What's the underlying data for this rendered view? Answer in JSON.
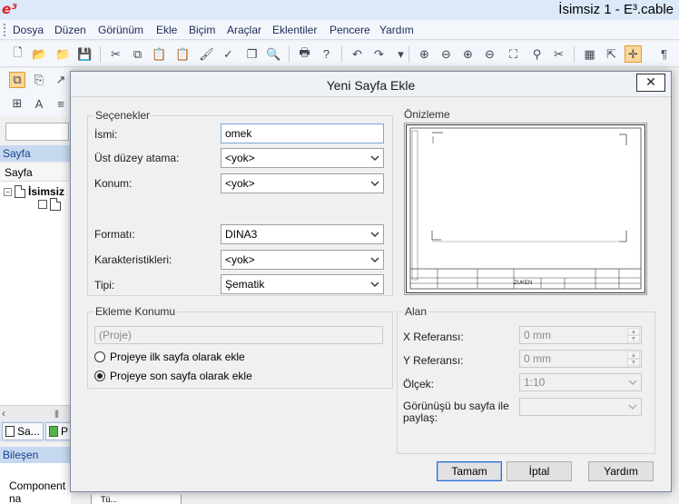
{
  "app": {
    "logo": "e³",
    "title": "İsimsiz 1 - E³.cable"
  },
  "menu": [
    "Dosya",
    "Düzen",
    "Görünüm",
    "Ekle",
    "Biçim",
    "Araçlar",
    "Eklentiler",
    "Pencere",
    "Yardım"
  ],
  "left_panel": {
    "sheet_panel_title": "Sayfa",
    "tree_header": "Sayfa",
    "tree_root": "İsimsiz",
    "bottom_tabs": [
      "Sa...",
      "P"
    ],
    "component_panel_title": "Bileşen",
    "component_label": "Component na",
    "bottom_strip_text": "Tü..."
  },
  "dialog": {
    "title": "Yeni Sayfa Ekle",
    "close_symbol": "✕",
    "options": {
      "legend": "Seçenekler",
      "name_label": "İsmi:",
      "name_value": "omek",
      "parent_label": "Üst düzey atama:",
      "parent_value": "<yok>",
      "location_label": "Konum:",
      "location_value": "<yok>",
      "format_label": "Formatı:",
      "format_value": "DINA3",
      "characteristics_label": "Karakteristikleri:",
      "characteristics_value": "<yok>",
      "type_label": "Tipi:",
      "type_value": "Şematik"
    },
    "insert_position": {
      "legend": "Ekleme Konumu",
      "project_value": "(Proje)",
      "radio_first": "Projeye ilk sayfa olarak ekle",
      "radio_last": "Projeye son sayfa olarak ekle",
      "selected": "last"
    },
    "preview": {
      "legend": "Önizleme",
      "title_block_text": "ZUKEN"
    },
    "area": {
      "legend": "Alan",
      "x_ref_label": "X Referansı:",
      "x_ref_value": "0 mm",
      "y_ref_label": "Y Referansı:",
      "y_ref_value": "0 mm",
      "scale_label": "Ölçek:",
      "scale_value": "1:10",
      "share_label": "Görünüşü bu sayfa ile paylaş:",
      "share_value": ""
    },
    "buttons": {
      "ok": "Tamam",
      "cancel": "İptal",
      "help": "Yardım"
    }
  }
}
